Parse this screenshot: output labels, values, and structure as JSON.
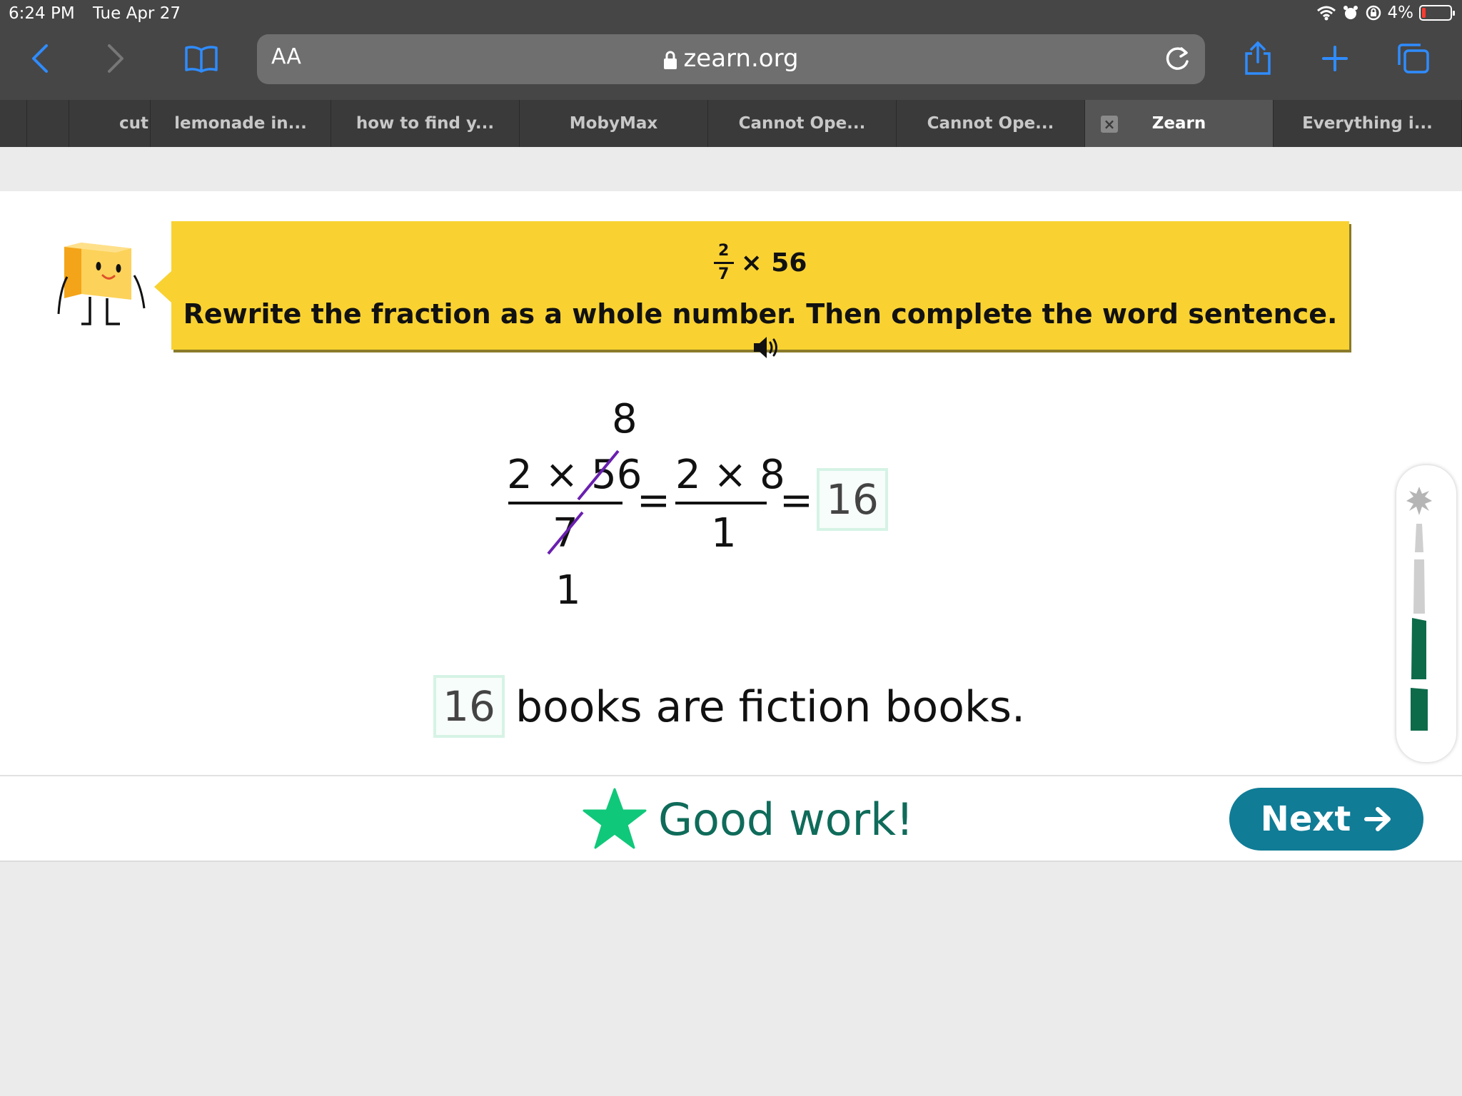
{
  "status_bar": {
    "time": "6:24 PM",
    "date": "Tue Apr 27",
    "battery": "4%"
  },
  "browser": {
    "text_size_label": "AA",
    "url": "zearn.org",
    "tabs": [
      {
        "label": ""
      },
      {
        "label": "cut"
      },
      {
        "label": "lemonade in..."
      },
      {
        "label": "how to find y..."
      },
      {
        "label": "MobyMax"
      },
      {
        "label": "Cannot Ope..."
      },
      {
        "label": "Cannot Ope..."
      },
      {
        "label": "Zearn",
        "active": true
      },
      {
        "label": "Everything i..."
      }
    ]
  },
  "prompt": {
    "expr_numerator": "2",
    "expr_denominator": "7",
    "expr_rest": "× 56",
    "instruction": "Rewrite the fraction as a whole number. Then complete the word sentence."
  },
  "math": {
    "cancel_top": "8",
    "frac1_numerator_left": "2 × ",
    "frac1_numerator_struck": "56",
    "frac1_denominator_struck": "7",
    "cancel_bottom": "1",
    "equals": "=",
    "frac2_numerator": "2 × 8",
    "frac2_denominator": "1",
    "answer": "16"
  },
  "sentence": {
    "answer": "16",
    "text": "books are fiction books."
  },
  "feedback": {
    "message": "Good work!",
    "next_label": "Next"
  },
  "colors": {
    "banner": "#f9d232",
    "next_button": "#107c96",
    "star": "#10c87a",
    "strike": "#6a1fb0",
    "progress_done": "#0d6b4a"
  }
}
